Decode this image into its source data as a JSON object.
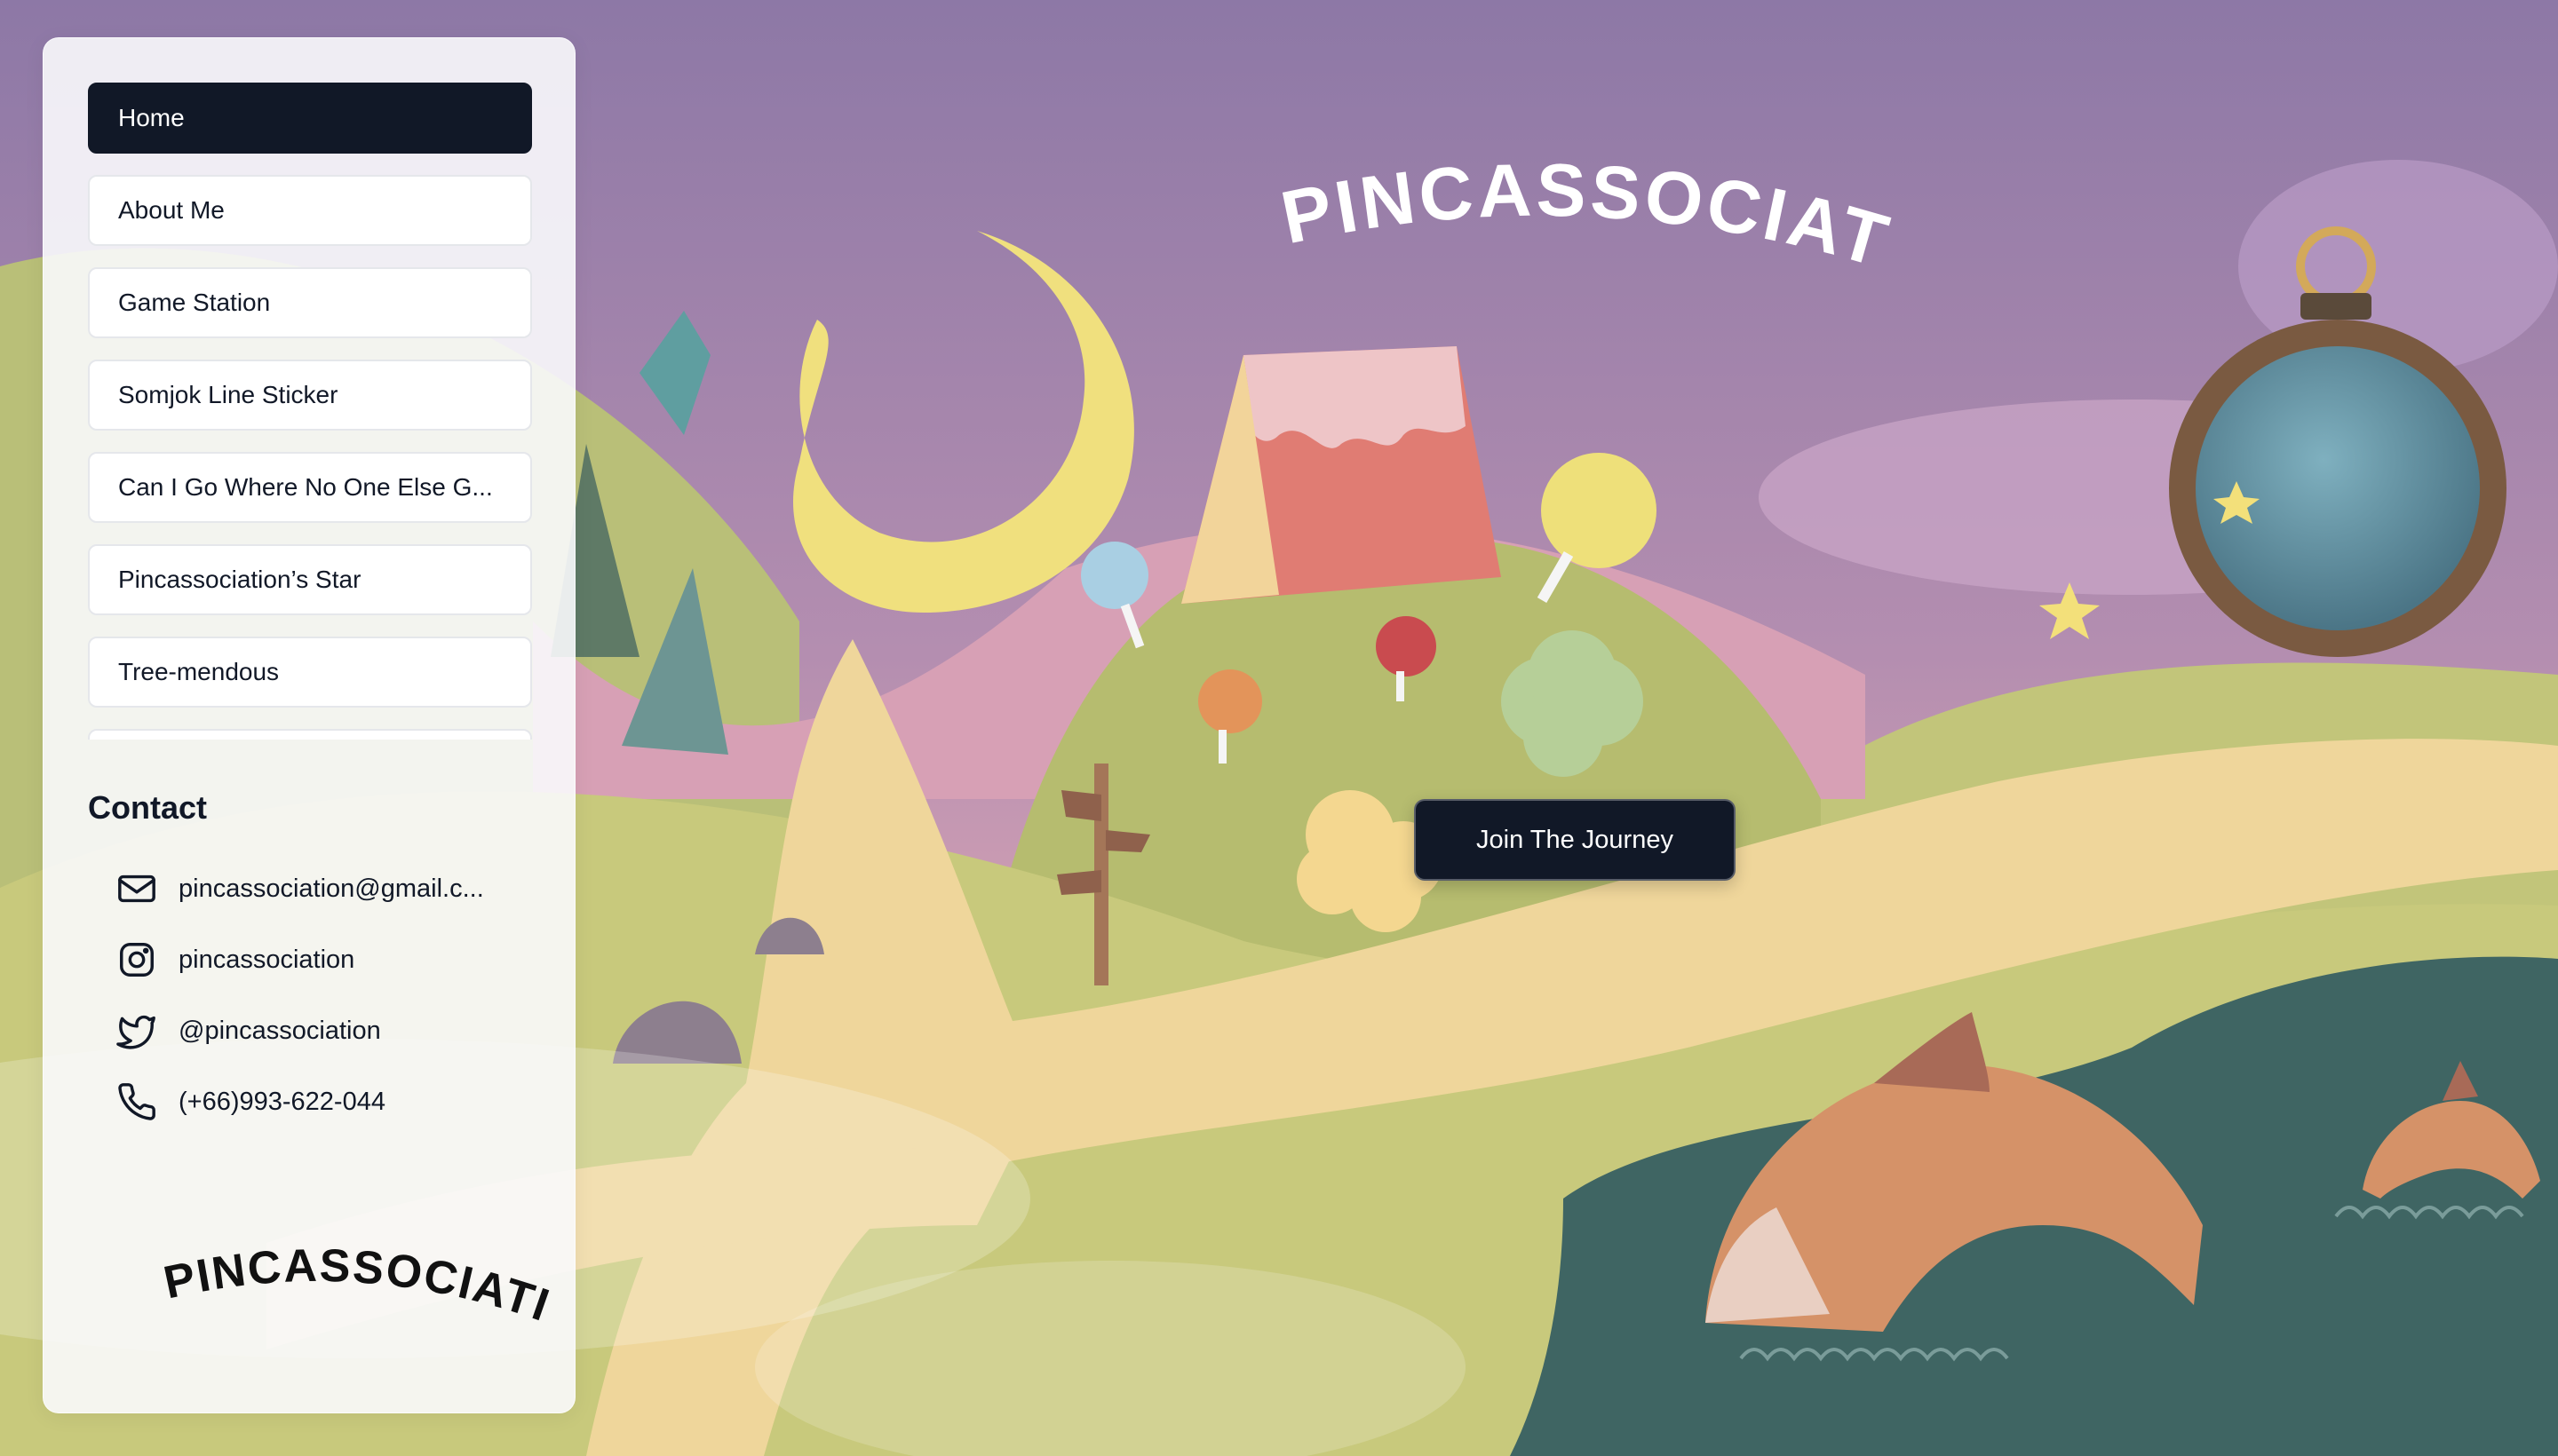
{
  "brand": {
    "title": "PINCASSOCIATION",
    "logo_text": "PINCASSOCIATION"
  },
  "nav": {
    "items": [
      {
        "label": "Home",
        "active": true
      },
      {
        "label": "About Me"
      },
      {
        "label": "Game Station"
      },
      {
        "label": "Somjok Line Sticker"
      },
      {
        "label": "Can I Go Where No One Else G..."
      },
      {
        "label": "Pincassociation’s Star"
      },
      {
        "label": "Tree-mendous"
      },
      {
        "label": ""
      }
    ]
  },
  "contact": {
    "title": "Contact",
    "email": "pincassociation@gmail.c...",
    "instagram": "pincassociation",
    "twitter": "@pincassociation",
    "phone": "(+66)993-622-044"
  },
  "cta": {
    "label": "Join The Journey"
  },
  "colors": {
    "sky": "#8e7aa6",
    "hill": "#c6c77a",
    "path": "#efd79c",
    "water": "#3f6563",
    "moon": "#f0e07e",
    "button": "#111827"
  }
}
